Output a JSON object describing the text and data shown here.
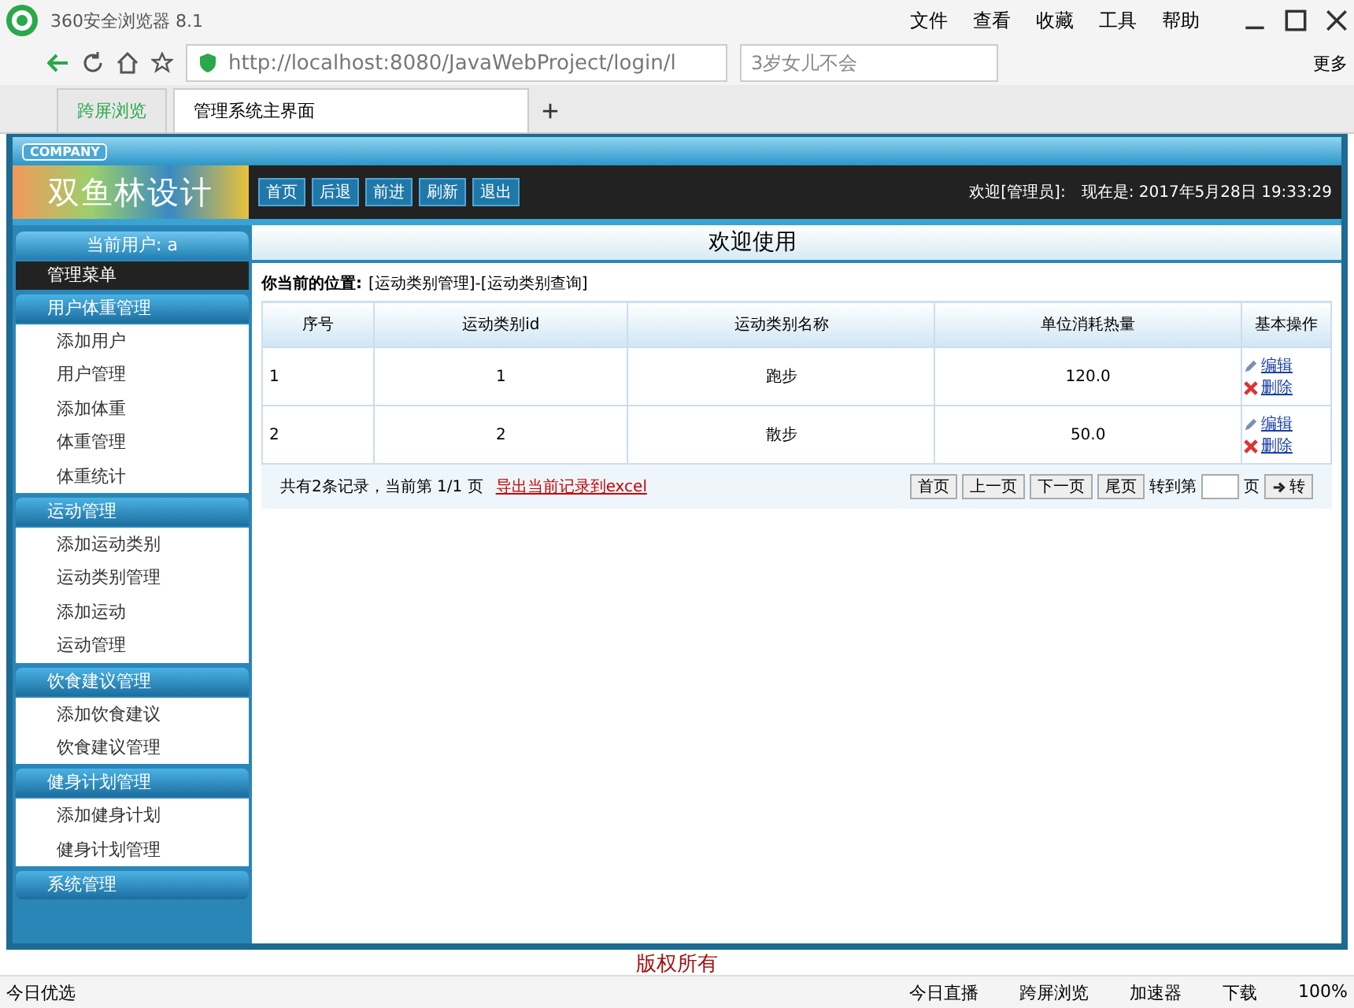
{
  "browser": {
    "title": "360安全浏览器 8.1",
    "menu": [
      "文件",
      "查看",
      "收藏",
      "工具",
      "帮助"
    ],
    "address": "http://localhost:8080/JavaWebProject/login/l",
    "search": "3岁女儿不会",
    "more": "更多",
    "tabs": [
      {
        "label": "跨屏浏览",
        "selected": false
      },
      {
        "label": "管理系统主界面",
        "selected": true
      }
    ]
  },
  "header": {
    "company": "COMPANY",
    "logo": "双鱼林设计",
    "nav": [
      "首页",
      "后退",
      "前进",
      "刷新",
      "退出"
    ],
    "welcome": "欢迎[管理员]:",
    "time": "现在是: 2017年5月28日 19:33:29"
  },
  "sidebar": {
    "user": "当前用户: a",
    "menu_title": "管理菜单",
    "groups": [
      {
        "title": "用户体重管理",
        "expanded": true,
        "items": [
          "添加用户",
          "用户管理",
          "添加体重",
          "体重管理",
          "体重统计"
        ]
      },
      {
        "title": "运动管理",
        "expanded": true,
        "items": [
          "添加运动类别",
          "运动类别管理",
          "添加运动",
          "运动管理"
        ]
      },
      {
        "title": "饮食建议管理",
        "expanded": true,
        "items": [
          "添加饮食建议",
          "饮食建议管理"
        ]
      },
      {
        "title": "健身计划管理",
        "expanded": true,
        "items": [
          "添加健身计划",
          "健身计划管理"
        ]
      },
      {
        "title": "系统管理",
        "expanded": false
      }
    ]
  },
  "main": {
    "banner": "欢迎使用",
    "location_label": "你当前的位置:",
    "location": "[运动类别管理]-[运动类别查询]",
    "table": {
      "columns": [
        "序号",
        "运动类别id",
        "运动类别名称",
        "单位消耗热量",
        "基本操作"
      ],
      "rows": [
        {
          "cells": [
            "1",
            "1",
            "跑步",
            "120.0"
          ],
          "actions": [
            "编辑",
            "删除"
          ]
        },
        {
          "cells": [
            "2",
            "2",
            "散步",
            "50.0"
          ],
          "actions": [
            "编辑",
            "删除"
          ]
        }
      ]
    },
    "summary": "共有2条记录，当前第 1/1 页",
    "export_link": "导出当前记录到excel",
    "pager": [
      "首页",
      "上一页",
      "下一页",
      "尾页"
    ],
    "goto_label": "转到第",
    "page_label": "页",
    "go": "转"
  },
  "footer": "版权所有",
  "status_bar": {
    "left": "今日优选",
    "items": [
      "今日直播",
      "跨屏浏览",
      "加速器",
      "下载"
    ],
    "zoom": "100%"
  }
}
